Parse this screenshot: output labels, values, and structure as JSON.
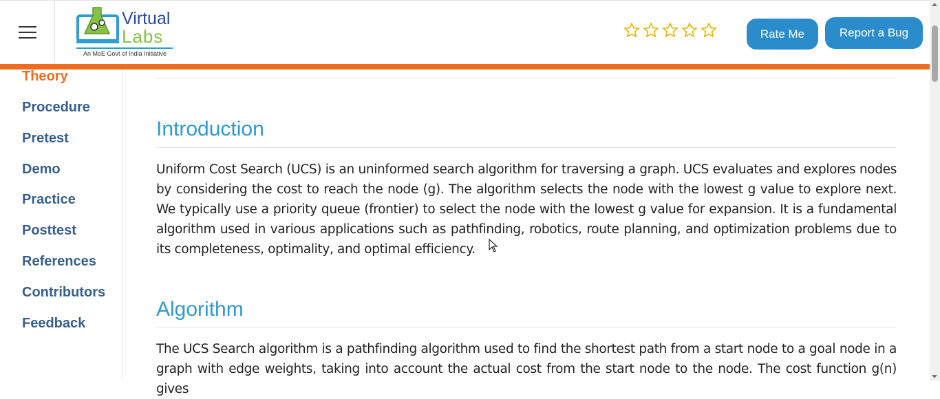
{
  "header": {
    "logo": {
      "line1": "Virtual",
      "line2": "Labs",
      "tagline": "An MoE Govt of India Initiative"
    },
    "rating_stars": 5,
    "rate_label": "Rate Me",
    "bug_label": "Report a Bug"
  },
  "colors": {
    "accent_orange": "#f16c1f",
    "button_blue": "#2b8ccb",
    "heading_blue": "#2e9ad0",
    "nav_blue": "#365f8e"
  },
  "sidebar": {
    "items": [
      {
        "label": "Theory",
        "active": true
      },
      {
        "label": "Procedure"
      },
      {
        "label": "Pretest"
      },
      {
        "label": "Demo"
      },
      {
        "label": "Practice"
      },
      {
        "label": "Posttest"
      },
      {
        "label": "References"
      },
      {
        "label": "Contributors"
      },
      {
        "label": "Feedback"
      }
    ]
  },
  "content": {
    "sections": [
      {
        "heading": "Introduction",
        "text": "Uniform Cost Search (UCS) is an uninformed search algorithm for traversing a graph. UCS evaluates and explores nodes by considering the cost to reach the node (g). The algorithm selects the node with the lowest g value to explore next. We typically use a priority queue (frontier) to select the node with the lowest g value for expansion. It is a fundamental algorithm used in various applications such as pathfinding, robotics, route planning, and optimization problems due to its completeness, optimality, and optimal efficiency."
      },
      {
        "heading": "Algorithm",
        "text": "The UCS Search algorithm is a pathfinding algorithm used to find the shortest path from a start node to a goal node in a graph with edge weights, taking into account the actual cost from the start node to the node. The cost function g(n) gives"
      }
    ]
  }
}
